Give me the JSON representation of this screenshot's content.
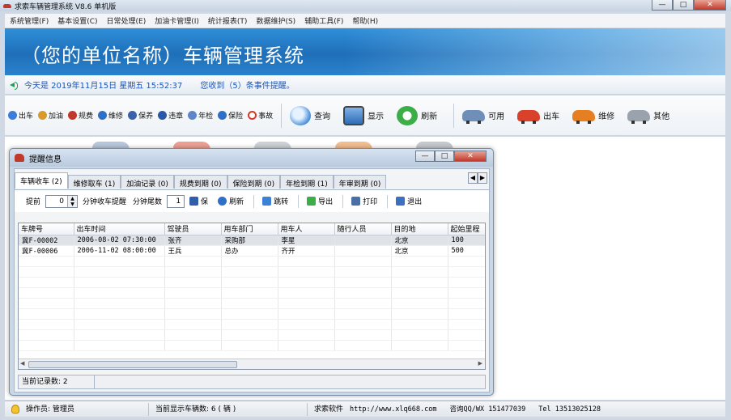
{
  "window": {
    "title": "求索车辆管理系统 V8.6 单机版",
    "buttons": {
      "minimize": "—",
      "maximize": "□",
      "close": "✕"
    }
  },
  "menu": [
    "系统管理(F)",
    "基本设置(C)",
    "日常处理(E)",
    "加油卡管理(I)",
    "统计报表(T)",
    "数据维护(S)",
    "辅助工具(F)",
    "帮助(H)"
  ],
  "banner": {
    "title": "（您的单位名称）车辆管理系统"
  },
  "info": {
    "date": "今天是  2019年11月15日  星期五  15:52:37",
    "notice": "您收到（5）条事件提醒。"
  },
  "toolbar": {
    "small": [
      {
        "label": "出车",
        "icon": "globe-icon",
        "color": "#3b7dd8"
      },
      {
        "label": "加油",
        "icon": "fuel-icon",
        "color": "#d89b2b"
      },
      {
        "label": "规费",
        "icon": "coin-icon",
        "color": "#c0392b"
      },
      {
        "label": "维修",
        "icon": "wrench-icon",
        "color": "#2e6fc7"
      },
      {
        "label": "保养",
        "icon": "tools-icon",
        "color": "#3a62a8"
      },
      {
        "label": "违章",
        "icon": "cross-icon",
        "color": "#2a58a8"
      },
      {
        "label": "年检",
        "icon": "check-icon",
        "color": "#5c86c8"
      },
      {
        "label": "保险",
        "icon": "shield-icon",
        "color": "#2e6fc7"
      },
      {
        "label": "事故",
        "icon": "forbidden-icon",
        "color": "#d03a2b"
      }
    ],
    "big": [
      {
        "label": "查询",
        "icon": "magnifier-icon",
        "color": "#4a90d9"
      },
      {
        "label": "显示",
        "icon": "monitor-icon",
        "color": "#2f6db5"
      },
      {
        "label": "刷新",
        "icon": "refresh-icon",
        "color": "#3cae47"
      }
    ],
    "cars": [
      {
        "label": "可用",
        "color": "#6f8fb8"
      },
      {
        "label": "出车",
        "color": "#d9412b"
      },
      {
        "label": "维修",
        "color": "#e67e22"
      },
      {
        "label": "其他",
        "color": "#9aa3ad"
      }
    ]
  },
  "popup": {
    "title": "提醒信息",
    "tabs": [
      "车辆收车 (2)",
      "维修取车 (1)",
      "加油记录 (0)",
      "规费到期 (0)",
      "保险到期 (0)",
      "年检到期 (1)",
      "年审到期 (0)"
    ],
    "toolbar": {
      "before_label": "提前",
      "minutes_value": "0",
      "minutes_label": "分钟收车提醒",
      "tail_label": "分钟尾数",
      "tail_value": "1",
      "save": "保",
      "refresh": "刷新",
      "jump": "跳转",
      "export": "导出",
      "print": "打印",
      "exit": "退出"
    },
    "table": {
      "columns": [
        "车牌号",
        "出车时间",
        "驾驶员",
        "用车部门",
        "用车人",
        "随行人员",
        "目的地",
        "起始里程"
      ],
      "rows": [
        [
          "冀F-00002",
          "2006-08-02 07:30:00",
          "张齐",
          "采购部",
          "李星",
          "",
          "北京",
          "100"
        ],
        [
          "冀F-00006",
          "2006-11-02 08:00:00",
          "王兵",
          "总办",
          "齐开",
          "",
          "北京",
          "500"
        ]
      ],
      "empty_rows": 9
    },
    "status": "当前记录数: 2"
  },
  "statusbar": {
    "operator": "操作员: 管理员",
    "count": "当前显示车辆数: 6 ( 辆 )",
    "vendor": "求索软件",
    "url": "http://www.xlq668.com",
    "qq": "咨询QQ/WX 151477039",
    "tel": "Tel 13513025128"
  }
}
